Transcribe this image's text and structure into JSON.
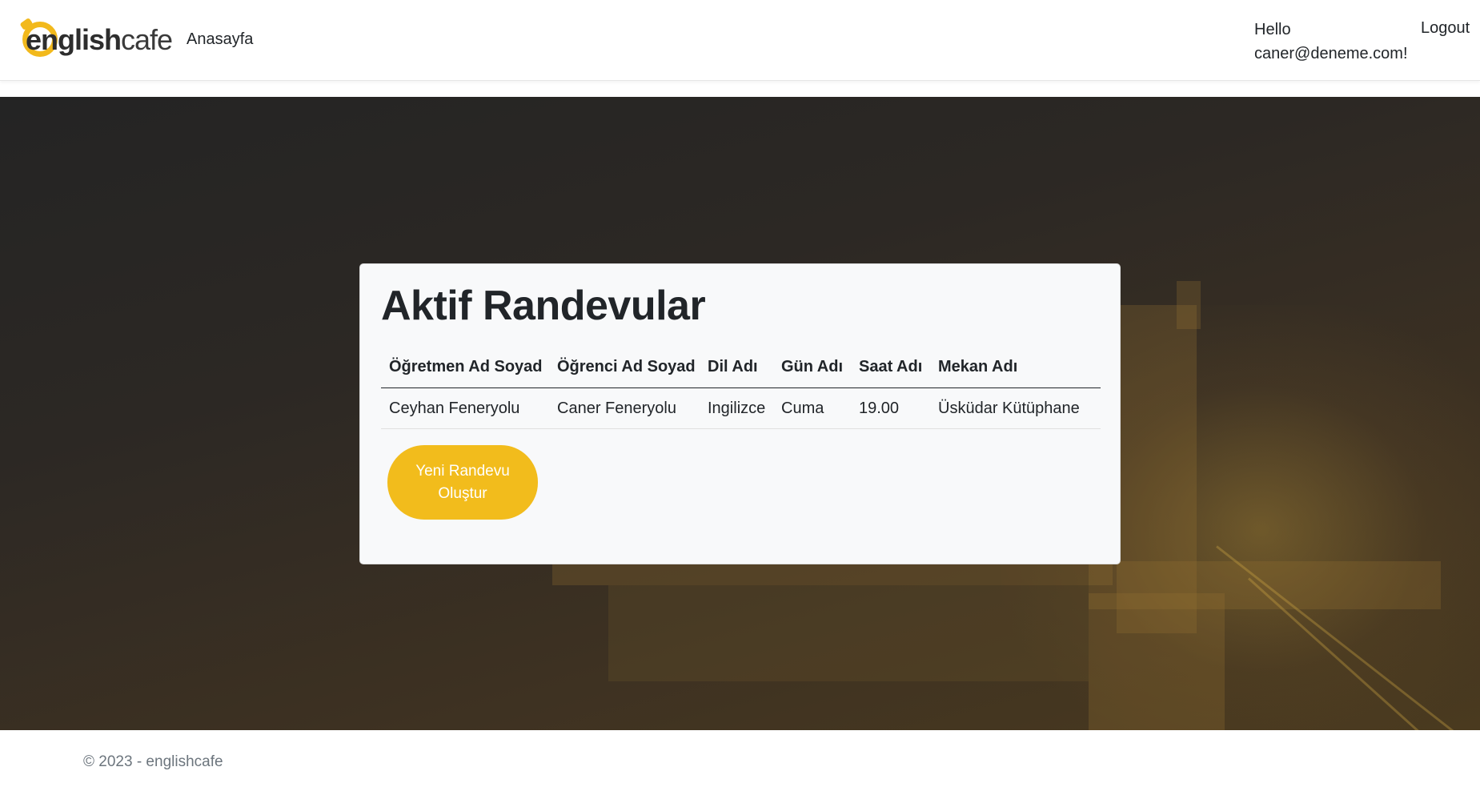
{
  "header": {
    "brand": {
      "bold_part": "english",
      "light_part": "cafe"
    },
    "nav_home": "Anasayfa",
    "greeting": "Hello caner@deneme.com!",
    "logout": "Logout"
  },
  "card": {
    "title": "Aktif Randevular",
    "columns": [
      "Öğretmen Ad Soyad",
      "Öğrenci Ad Soyad",
      "Dil Adı",
      "Gün Adı",
      "Saat Adı",
      "Mekan Adı"
    ],
    "rows": [
      [
        "Ceyhan Feneryolu",
        "Caner Feneryolu",
        "Ingilizce",
        "Cuma",
        "19.00",
        "Üsküdar Kütüphane"
      ]
    ],
    "new_button": "Yeni Randevu Oluştur"
  },
  "footer": {
    "copyright": "© 2023 - englishcafe"
  },
  "colors": {
    "accent": "#f2bc1c",
    "text": "#212529",
    "muted": "#6c757d",
    "card_bg": "#f8f9fa"
  }
}
